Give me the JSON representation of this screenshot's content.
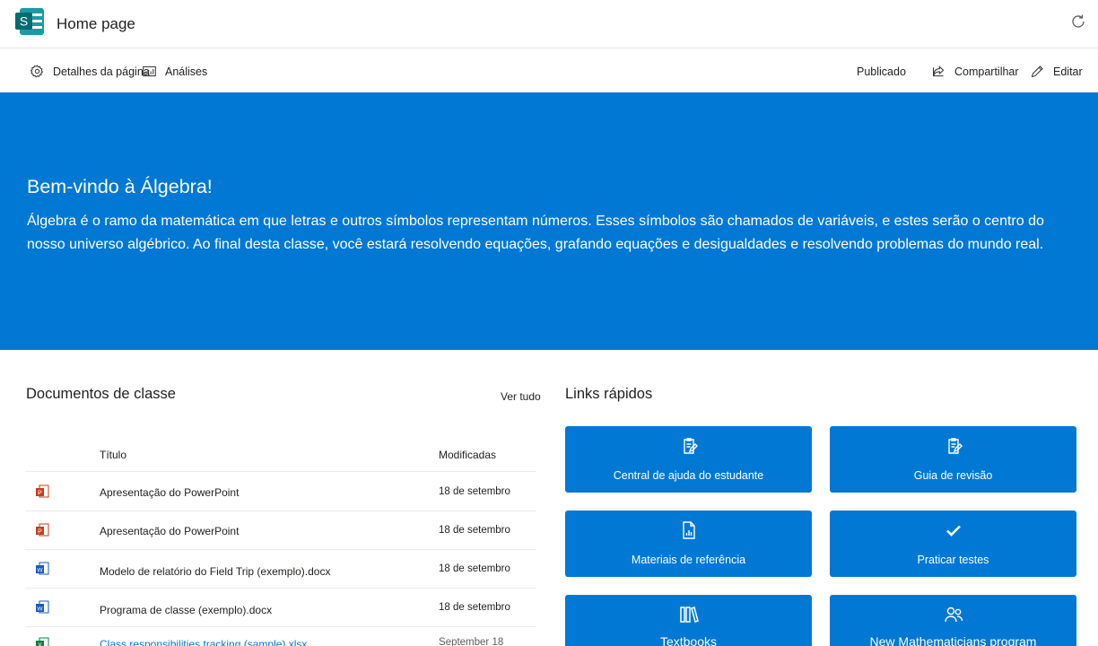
{
  "header": {
    "title": "Home page"
  },
  "commands": {
    "page_details": "Detalhes da página",
    "analytics": "Análises",
    "published": "Publicado",
    "share": "Compartilhar",
    "edit": "Editar"
  },
  "hero": {
    "title": "Bem-vindo à Álgebra!",
    "text": "Álgebra é o ramo da matemática em que letras e outros símbolos representam números. Esses símbolos são chamados de variáveis, e estes serão o centro do nosso universo algébrico. Ao final desta classe, você estará resolvendo equações, grafando equações e desigualdades e resolvendo problemas do mundo real."
  },
  "documents": {
    "title": "Documentos de classe",
    "see_all": "Ver tudo",
    "col_title": "Título",
    "col_modified": "Modificadas",
    "rows": [
      {
        "name": "Apresentação do PowerPoint",
        "date": "18 de setembro",
        "type": "powerpoint"
      },
      {
        "name": "Apresentação do PowerPoint",
        "date": "18 de setembro",
        "type": "powerpoint"
      },
      {
        "name": "Modelo de relatório do Field Trip (exemplo).docx",
        "date": "18 de setembro",
        "type": "word"
      },
      {
        "name": "Programa de classe (exemplo).docx",
        "date": "18 de setembro",
        "type": "word"
      },
      {
        "name": "Class responsibilities tracking (sample).xlsx",
        "date": "September 18",
        "type": "excel"
      }
    ]
  },
  "quick_links": {
    "title": "Links rápidos",
    "items": [
      {
        "label": "Central de ajuda do estudante",
        "icon": "clipboard-edit-icon"
      },
      {
        "label": "Guia de revisão",
        "icon": "clipboard-edit-icon"
      },
      {
        "label": "Materiais de referência",
        "icon": "report-document-icon"
      },
      {
        "label": "Praticar testes",
        "icon": "checkmark-icon"
      },
      {
        "label": "Textbooks",
        "icon": "library-books-icon"
      },
      {
        "label": "New Mathematicians program",
        "icon": "people-icon"
      }
    ]
  },
  "colors": {
    "accent": "#0078d4",
    "text": "#201f1e",
    "sharepoint": "#036c70"
  }
}
